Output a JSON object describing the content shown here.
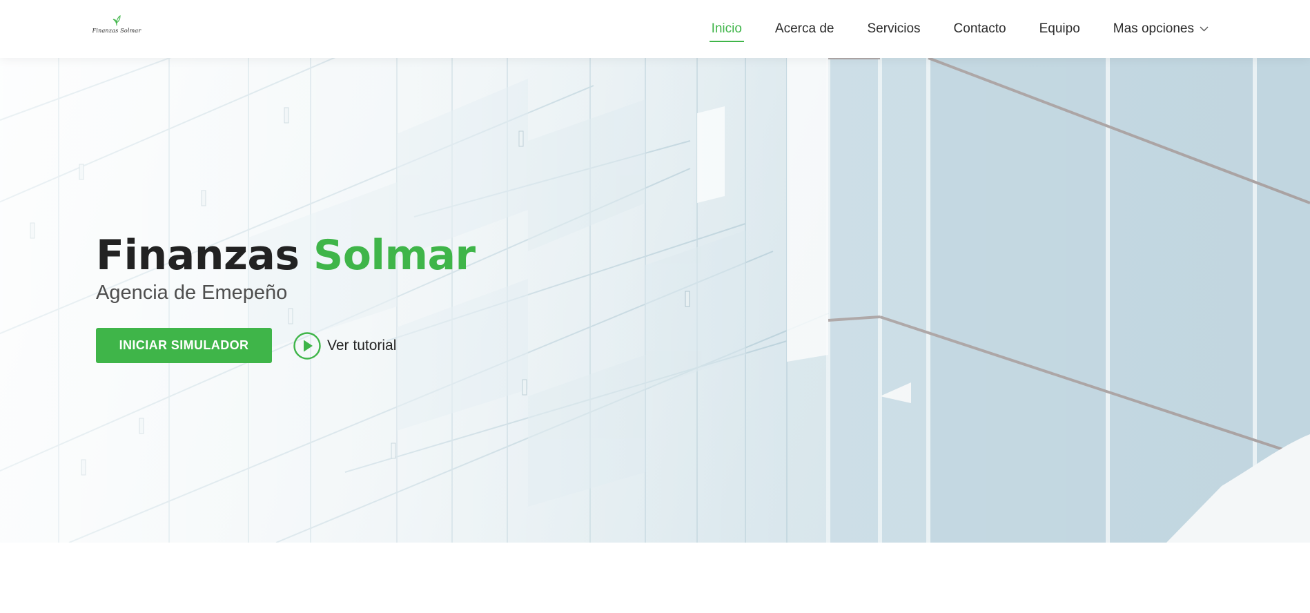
{
  "brand": {
    "logo_text": "Finanzas Solmar",
    "logo_icon": "leaf-icon"
  },
  "nav": {
    "items": [
      {
        "label": "Inicio",
        "active": true
      },
      {
        "label": "Acerca de",
        "active": false
      },
      {
        "label": "Servicios",
        "active": false
      },
      {
        "label": "Contacto",
        "active": false
      },
      {
        "label": "Equipo",
        "active": false
      },
      {
        "label": "Mas opciones",
        "active": false,
        "icon": "chevron-down-icon"
      }
    ]
  },
  "hero": {
    "title_main": "Finanzas",
    "title_accent": "Solmar",
    "subtitle": "Agencia de Emepeño",
    "cta_label": "INICIAR SIMULADOR",
    "tutorial_label": "Ver tutorial",
    "tutorial_icon": "play-circle-icon",
    "background": "glass-building-facade-image"
  },
  "colors": {
    "accent": "#3fb549",
    "text_dark": "#222222",
    "text_muted": "#4e4e4e"
  }
}
